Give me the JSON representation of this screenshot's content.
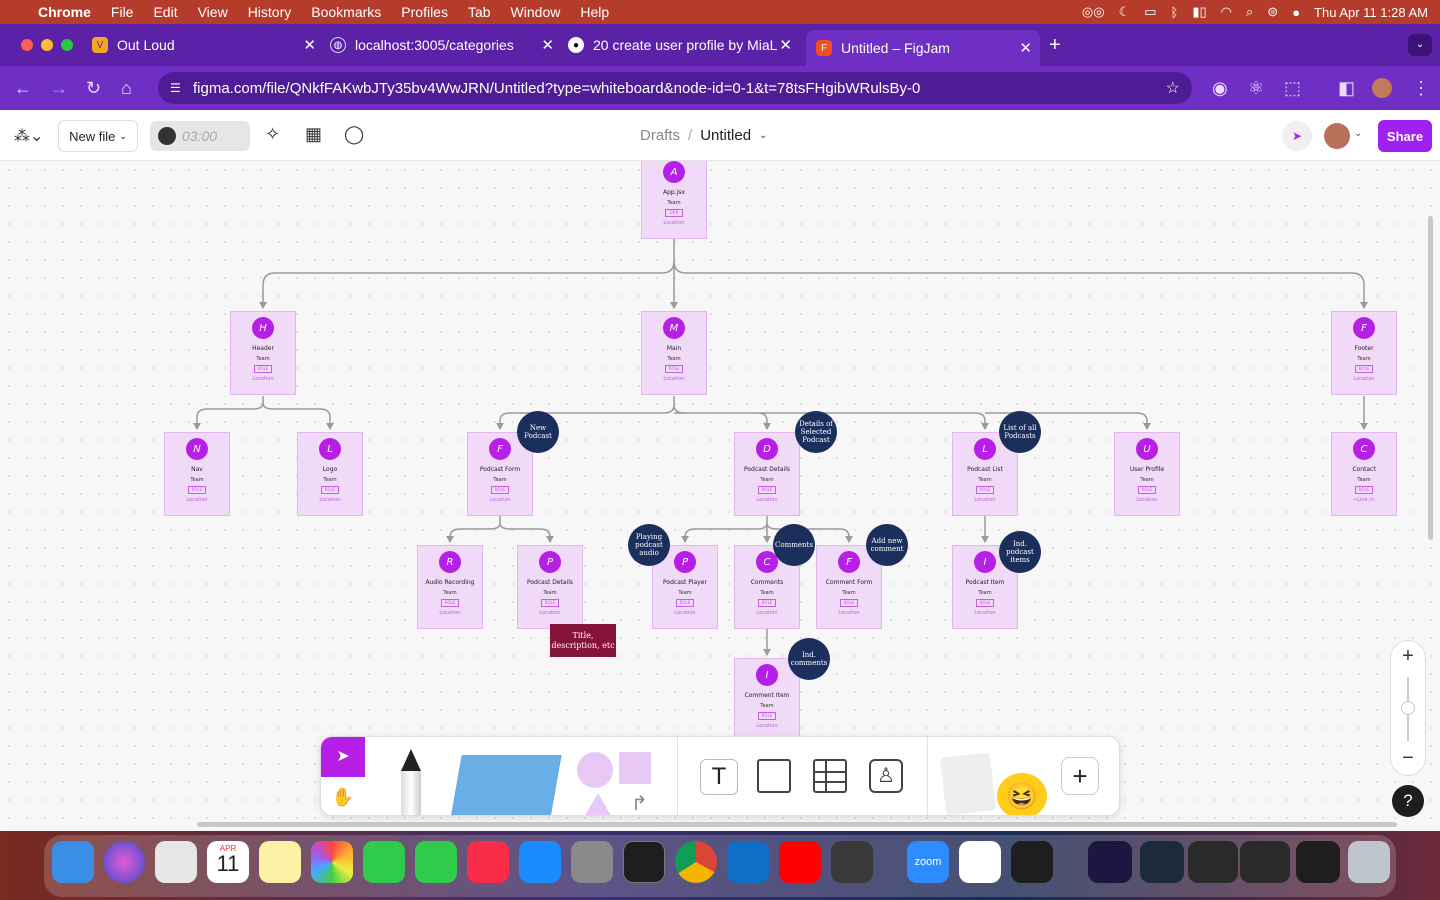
{
  "menubar": {
    "app": "Chrome",
    "items": [
      "File",
      "Edit",
      "View",
      "History",
      "Bookmarks",
      "Profiles",
      "Tab",
      "Window",
      "Help"
    ],
    "datetime": "Thu Apr 11  1:28 AM"
  },
  "tabs": [
    {
      "title": "Out Loud"
    },
    {
      "title": "localhost:3005/categories"
    },
    {
      "title": "20 create user profile by MiaL"
    },
    {
      "title": "Untitled – FigJam"
    }
  ],
  "address": {
    "url": "figma.com/file/QNkfFAKwbJTy35bv4WwJRN/Untitled?type=whiteboard&node-id=0-1&t=78tsFHgibWRulsBy-0"
  },
  "figjam": {
    "new_file": "New file",
    "timer": "03:00",
    "breadcrumb_parent": "Drafts",
    "breadcrumb_sep": "/",
    "file_name": "Untitled",
    "share": "Share"
  },
  "nodes": {
    "app": {
      "initial": "A",
      "name": "App.jsx",
      "team": "Team",
      "role": "ORR",
      "loc": "Location"
    },
    "header": {
      "initial": "H",
      "name": "Header",
      "team": "Team",
      "role": "ROLE",
      "loc": "Location"
    },
    "main": {
      "initial": "M",
      "name": "Main",
      "team": "Team",
      "role": "ROLE",
      "loc": "Location"
    },
    "footer": {
      "initial": "F",
      "name": "Footer",
      "team": "Team",
      "role": "ROLE",
      "loc": "Location"
    },
    "nav": {
      "initial": "N",
      "name": "Nav",
      "team": "Team",
      "role": "ROLE",
      "loc": "Location"
    },
    "logo": {
      "initial": "L",
      "name": "Logo",
      "team": "Team",
      "role": "ROLE",
      "loc": "Location"
    },
    "podform": {
      "initial": "F",
      "name": "Podcast Form",
      "team": "Team",
      "role": "ROLE",
      "loc": "Location"
    },
    "poddetails": {
      "initial": "D",
      "name": "Podcast Details",
      "team": "Team",
      "role": "ROLE",
      "loc": "Location"
    },
    "podlist": {
      "initial": "L",
      "name": "Podcast List",
      "team": "Team",
      "role": "ROLE",
      "loc": "Location"
    },
    "userprofile": {
      "initial": "U",
      "name": "User Profile",
      "team": "Team",
      "role": "ROLE",
      "loc": "Location"
    },
    "contact": {
      "initial": "C",
      "name": "Contact",
      "team": "Team",
      "role": "ROLE",
      "loc": "<Link />"
    },
    "audiorec": {
      "initial": "R",
      "name": "Audio Recording",
      "team": "Team",
      "role": "ROLE",
      "loc": "Location"
    },
    "poddetails2": {
      "initial": "P",
      "name": "Podcast Details",
      "team": "Team",
      "role": "ROLE",
      "loc": "Location"
    },
    "podplayer": {
      "initial": "P",
      "name": "Podcast Player",
      "team": "Team",
      "role": "ROLE",
      "loc": "Location"
    },
    "comments": {
      "initial": "C",
      "name": "Comments",
      "team": "Team",
      "role": "ROLE",
      "loc": "Location"
    },
    "commentform": {
      "initial": "F",
      "name": "Comment Form",
      "team": "Team",
      "role": "ROLE",
      "loc": "Location"
    },
    "poditem": {
      "initial": "I",
      "name": "Podcast Item",
      "team": "Team",
      "role": "ROLE",
      "loc": "Location"
    },
    "commentitem": {
      "initial": "I",
      "name": "Comment Item",
      "team": "Team",
      "role": "ROLE",
      "loc": "Location"
    }
  },
  "bubbles": {
    "newpodcast": "New Podcast",
    "details": "Details of Selected Podcast",
    "listall": "List of all Podcasts",
    "playing": "Playing podcast audio",
    "comments": "Comments",
    "addnew": "Add new comment",
    "indpodcast": "Ind. podcast items",
    "indcomments": "Ind. comments"
  },
  "sticky": {
    "text": "Title, description, etc"
  },
  "dock": {
    "calendar_month": "APR",
    "calendar_day": "11",
    "zoom": "zoom"
  }
}
